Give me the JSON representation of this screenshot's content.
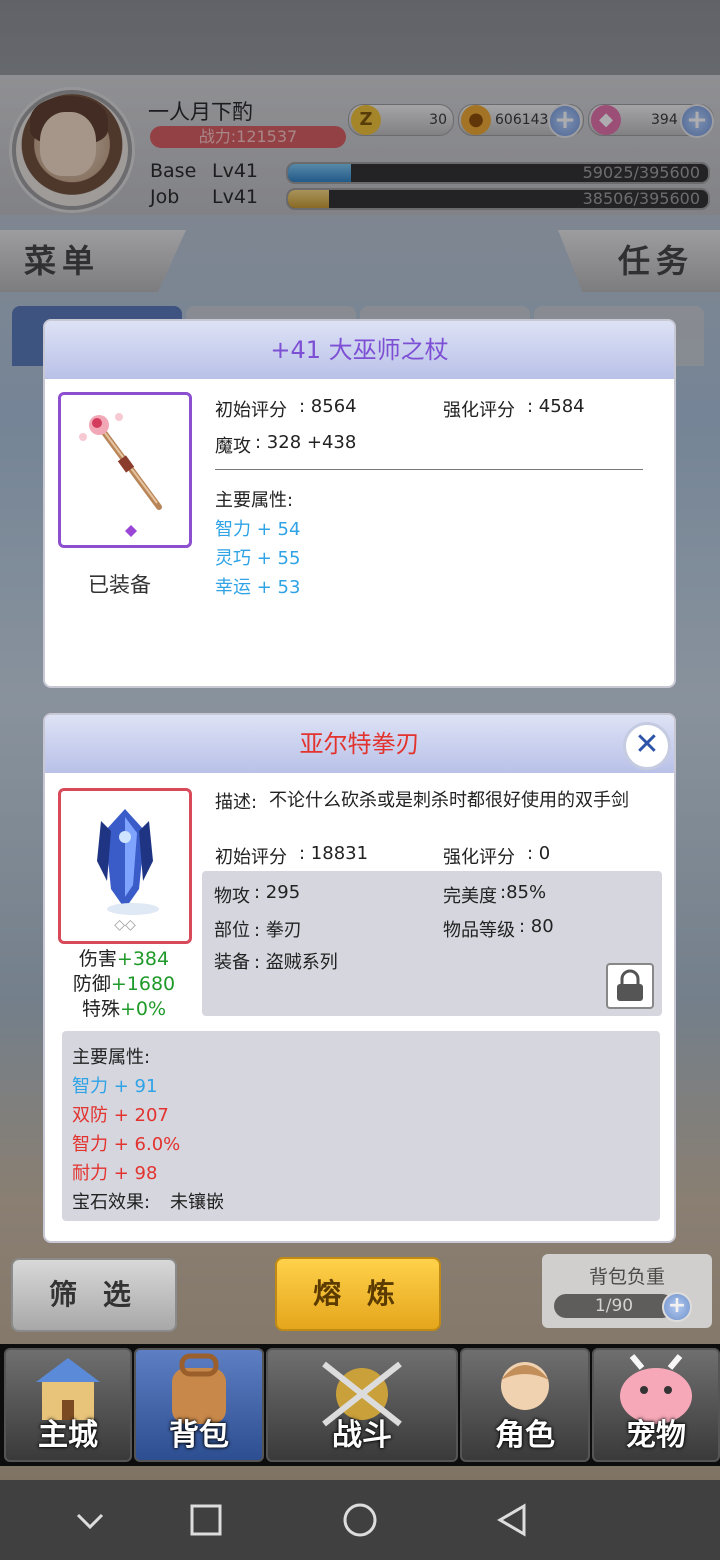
{
  "player": {
    "name": "一人月下酌",
    "power": "战力:121537",
    "currency": [
      {
        "icon": "z-coin-icon",
        "value": "30"
      },
      {
        "icon": "gold-coin-icon",
        "value": "606143"
      },
      {
        "icon": "gem-icon",
        "value": "394"
      }
    ],
    "base": {
      "label": "Base",
      "level": "Lv41",
      "exp": "59025/395600",
      "fraction": 0.149
    },
    "job": {
      "label": "Job",
      "level": "Lv41",
      "exp": "38506/395600",
      "fraction": 0.097
    }
  },
  "side_buttons": {
    "menu": "菜单",
    "quest": "任务"
  },
  "equipped": {
    "title": "+41 大巫师之杖",
    "init_score_label": "初始评分",
    "init_score": ": 8564",
    "enh_score_label": "强化评分",
    "enh_score": ": 4584",
    "atk_label": "魔攻",
    "atk": ":  328 +438",
    "main_label": "主要属性:",
    "attrs": [
      "智力 + 54",
      "灵巧 + 55",
      "幸运 + 53"
    ],
    "status": "已装备"
  },
  "compare": {
    "title": "亚尔特拳刃",
    "desc_label": "描述:",
    "desc": "不论什么砍杀或是刺杀时都很好使用的双手剑",
    "init_score_label": "初始评分",
    "init_score": ": 18831",
    "enh_score_label": "强化评分",
    "enh_score": ": 0",
    "atk_label": "物攻",
    "atk": ":  295",
    "perfect_label": "完美度",
    "perfect": ":85%",
    "part_label": "部位",
    "part": ":  拳刃",
    "item_level_label": "物品等级",
    "item_level": ": 80",
    "equip_label": "装备",
    "equip": ":  盗贼系列",
    "diffs": [
      {
        "label": "伤害",
        "value": "+384"
      },
      {
        "label": "防御",
        "value": "+1680"
      },
      {
        "label": "特殊",
        "value": "+0%"
      }
    ],
    "main_label": "主要属性:",
    "attrs_blue": [
      "智力 + 91"
    ],
    "attrs_red": [
      "双防 + 207",
      "智力 + 6.0%",
      "耐力 + 98"
    ],
    "gem_label": "宝石效果:",
    "gem": "未镶嵌",
    "slots": "◇◇"
  },
  "bottom": {
    "filter": "筛 选",
    "smelt": "熔 炼",
    "bag_weight_label": "背包负重",
    "bag_weight": "1/90"
  },
  "nav": [
    "主城",
    "背包",
    "战斗",
    "角色",
    "宠物"
  ],
  "colors": {
    "accent_gold": "#f2b62b",
    "panel_head": "#c3cbee",
    "blue_attr": "#2fa3e6",
    "red_attr": "#e2332e"
  }
}
